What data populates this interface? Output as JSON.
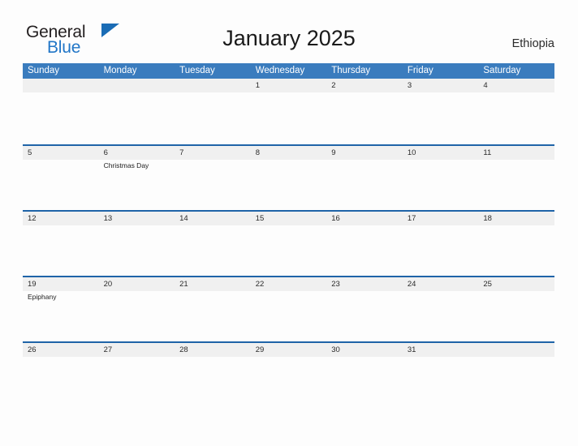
{
  "branding": {
    "logo_primary": "General",
    "logo_secondary": "Blue",
    "logo_triangle_color": "#1a6cb5",
    "logo_secondary_color": "#2176c7"
  },
  "header": {
    "title": "January 2025",
    "region": "Ethiopia"
  },
  "theme": {
    "header_blue": "#3a7cbe",
    "separator_blue": "#1f64a8",
    "strip_gray": "#f0f0f0",
    "page_background": "#fdfdfd"
  },
  "calendar": {
    "month": "January",
    "year": "2025",
    "weekday_headers": [
      "Sunday",
      "Monday",
      "Tuesday",
      "Wednesday",
      "Thursday",
      "Friday",
      "Saturday"
    ],
    "weeks": [
      {
        "days": [
          {
            "num": "",
            "event": ""
          },
          {
            "num": "",
            "event": ""
          },
          {
            "num": "",
            "event": ""
          },
          {
            "num": "1",
            "event": ""
          },
          {
            "num": "2",
            "event": ""
          },
          {
            "num": "3",
            "event": ""
          },
          {
            "num": "4",
            "event": ""
          }
        ]
      },
      {
        "days": [
          {
            "num": "5",
            "event": ""
          },
          {
            "num": "6",
            "event": "Christmas Day"
          },
          {
            "num": "7",
            "event": ""
          },
          {
            "num": "8",
            "event": ""
          },
          {
            "num": "9",
            "event": ""
          },
          {
            "num": "10",
            "event": ""
          },
          {
            "num": "11",
            "event": ""
          }
        ]
      },
      {
        "days": [
          {
            "num": "12",
            "event": ""
          },
          {
            "num": "13",
            "event": ""
          },
          {
            "num": "14",
            "event": ""
          },
          {
            "num": "15",
            "event": ""
          },
          {
            "num": "16",
            "event": ""
          },
          {
            "num": "17",
            "event": ""
          },
          {
            "num": "18",
            "event": ""
          }
        ]
      },
      {
        "days": [
          {
            "num": "19",
            "event": "Epiphany"
          },
          {
            "num": "20",
            "event": ""
          },
          {
            "num": "21",
            "event": ""
          },
          {
            "num": "22",
            "event": ""
          },
          {
            "num": "23",
            "event": ""
          },
          {
            "num": "24",
            "event": ""
          },
          {
            "num": "25",
            "event": ""
          }
        ]
      },
      {
        "days": [
          {
            "num": "26",
            "event": ""
          },
          {
            "num": "27",
            "event": ""
          },
          {
            "num": "28",
            "event": ""
          },
          {
            "num": "29",
            "event": ""
          },
          {
            "num": "30",
            "event": ""
          },
          {
            "num": "31",
            "event": ""
          },
          {
            "num": "",
            "event": ""
          }
        ]
      }
    ]
  }
}
